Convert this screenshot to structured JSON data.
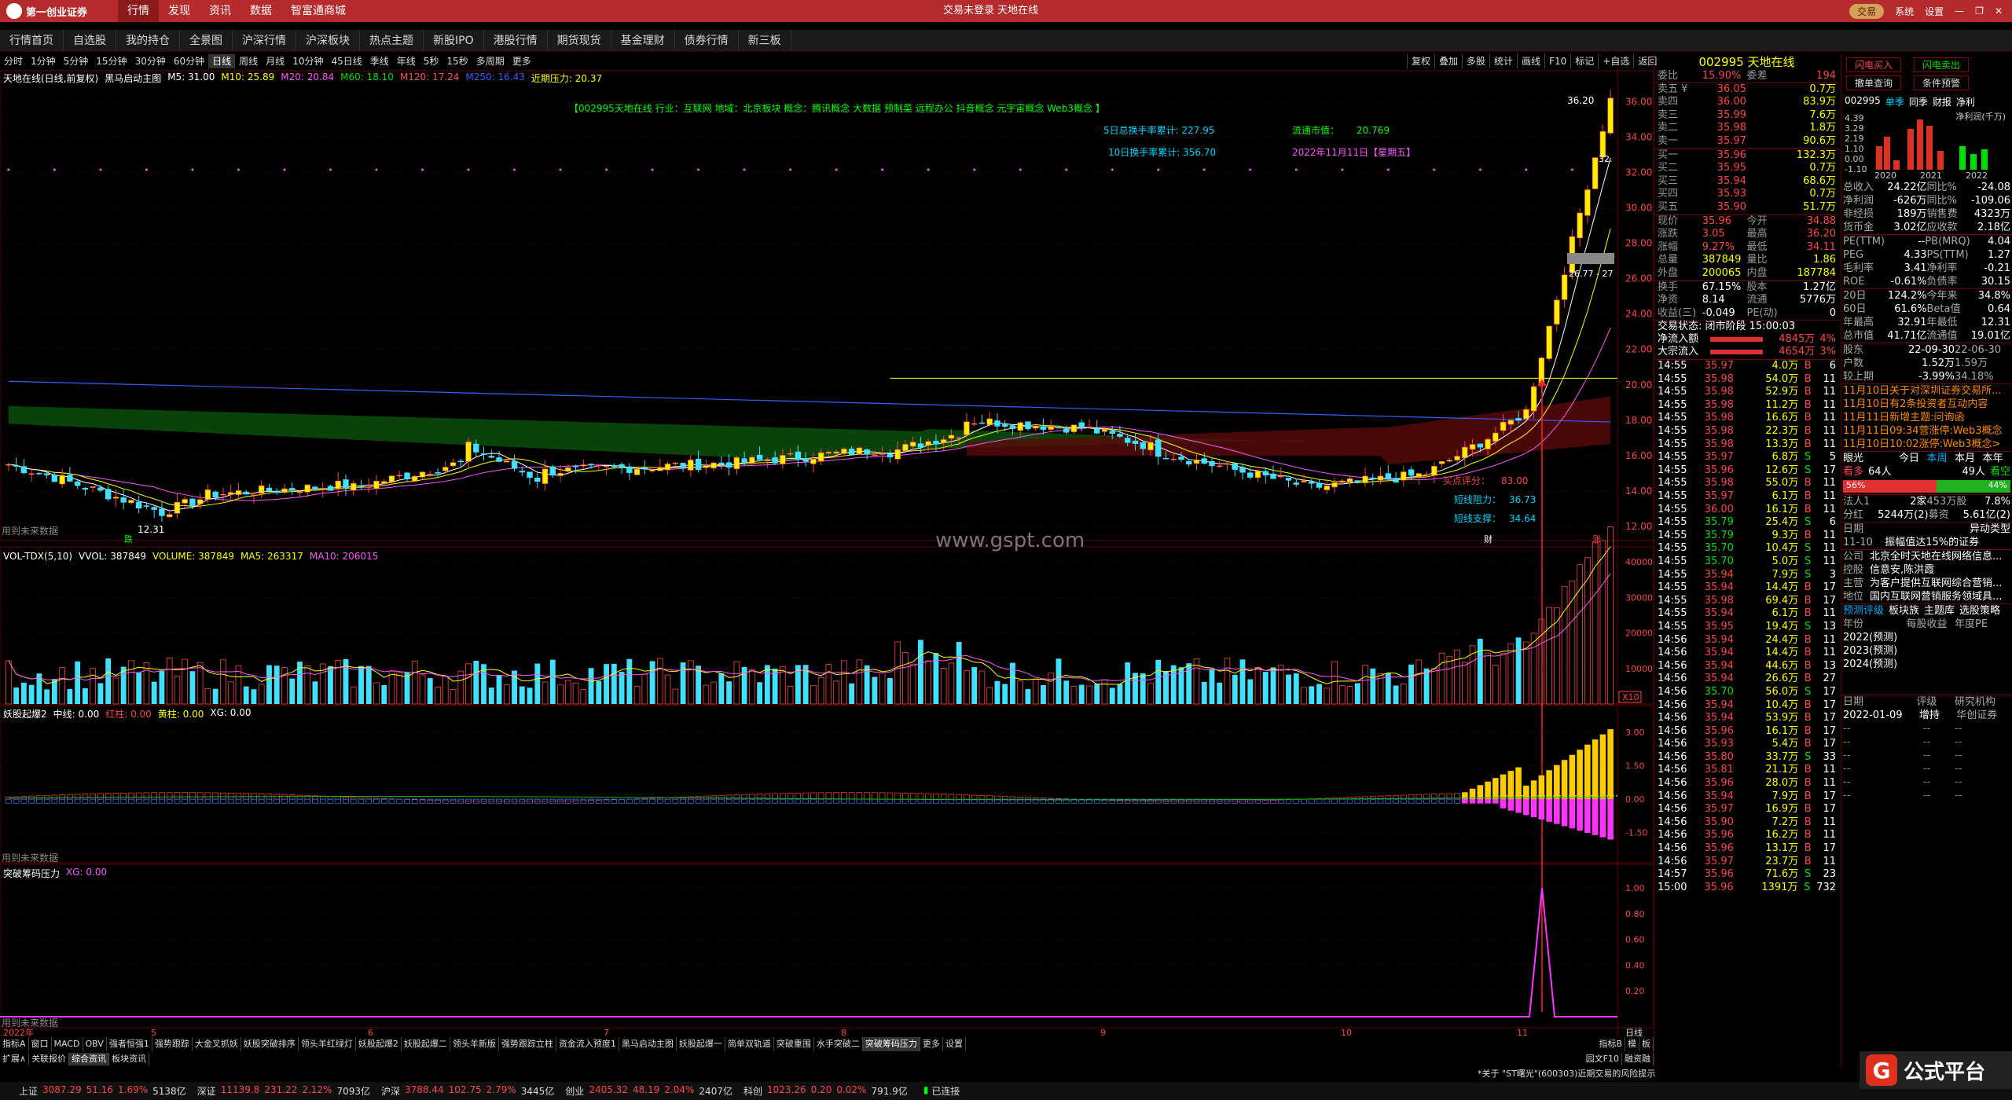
{
  "menubar": {
    "logo": "第一创业证券",
    "tabs": [
      "行情",
      "发现",
      "资讯",
      "数据",
      "智富通商城"
    ],
    "title": "交易未登录  天地在线",
    "trade": "交易",
    "system": "系统",
    "settings": "设置"
  },
  "subtabs": [
    "行情首页",
    "自选股",
    "我的持仓",
    "全景图",
    "沪深行情",
    "沪深板块",
    "热点主题",
    "新股IPO",
    "港股行情",
    "期货现货",
    "基金理财",
    "债券行情",
    "新三板"
  ],
  "periods": [
    "分时",
    "1分钟",
    "5分钟",
    "15分钟",
    "30分钟",
    "60分钟",
    "日线",
    "周线",
    "月线",
    "10分钟",
    "45日线",
    "季线",
    "年线",
    "5秒",
    "15秒",
    "多周期",
    "更多"
  ],
  "active_period": "日线",
  "chart_tools": [
    "复权",
    "叠加",
    "多股",
    "统计",
    "画线",
    "F10",
    "标记",
    "+自选",
    "返回"
  ],
  "main": {
    "stock": "天地在线(日线,前复权)",
    "indicator": "黑马启动主图",
    "ma": [
      {
        "label": "M5: 31.00",
        "color": "#ffffff"
      },
      {
        "label": "M10: 25.89",
        "color": "#ffff00"
      },
      {
        "label": "M20: 20.84",
        "color": "#ff55ff"
      },
      {
        "label": "M60: 18.10",
        "color": "#00e000"
      },
      {
        "label": "M120: 17.24",
        "color": "#ff5555"
      },
      {
        "label": "M250: 16.43",
        "color": "#3060ff"
      },
      {
        "label": "近期压力: 20.37",
        "color": "#ffff00"
      }
    ],
    "info": "【002995天地在线  行业：互联网  地域：北京板块  概念：腾讯概念 大数据 预制菜 远程办公 抖音概念 元宇宙概念 Web3概念 】",
    "turn5": "5日总换手率累计: 227.95",
    "turn10": "10日换手率累计: 356.70",
    "float": "流通市值：",
    "floatval": "20.769",
    "date": "2022年11月11日【星期五】",
    "hi": "36.20",
    "lo": "12.31",
    "box": "26.77 - 27",
    "pt32": "32.",
    "future": "用到未来数据",
    "buy_score": "买点评分：",
    "buy_val": "83.00",
    "short_res": "短线阻力：",
    "short_res_v": "36.73",
    "short_sup": "短线支撑：",
    "short_sup_v": "34.64",
    "zhang": "涨",
    "cai": "财",
    "die": "跌",
    "yaxis": [
      "36.00",
      "34.00",
      "32.00",
      "30.00",
      "28.00",
      "26.00",
      "24.00",
      "22.00",
      "20.00",
      "18.00",
      "16.00",
      "14.00",
      "12.00"
    ]
  },
  "vol": {
    "title": "VOL-TDX(5,10)",
    "items": [
      {
        "label": "VVOL: 387849",
        "color": "#ffffff"
      },
      {
        "label": "VOLUME: 387849",
        "color": "#ffff00"
      },
      {
        "label": "MA5: 263317",
        "color": "#ffff00"
      },
      {
        "label": "MA10: 206015",
        "color": "#ff55ff"
      }
    ],
    "yaxis": [
      "40000",
      "30000",
      "20000",
      "10000"
    ],
    "unit": "X10"
  },
  "ind2": {
    "title": "妖股起爆2",
    "items": [
      {
        "label": "中线: 0.00",
        "color": "#ffffff"
      },
      {
        "label": "红柱: 0.00",
        "color": "#ff4444"
      },
      {
        "label": "黄柱: 0.00",
        "color": "#ffff00"
      },
      {
        "label": "XG: 0.00",
        "color": "#ffffff"
      }
    ],
    "yaxis": [
      "3.00",
      "1.50",
      "0.00",
      "-1.50"
    ],
    "future": "用到未来数据"
  },
  "ind3": {
    "title": "突破筹码压力",
    "items": [
      {
        "label": "XG: 0.00",
        "color": "#ff55ff"
      }
    ],
    "yaxis": [
      "1.00",
      "0.80",
      "0.60",
      "0.40",
      "0.20"
    ],
    "future": "用到未来数据"
  },
  "xaxis": [
    "2022年",
    "5",
    "6",
    "7",
    "8",
    "9",
    "10",
    "11"
  ],
  "xaxis_right": "日线",
  "watermark": "www.gspt.com",
  "bottom_tabs": [
    "指标A",
    "窗口",
    "MACD",
    "OBV",
    "强者恒强1",
    "强势跟踪",
    "大金叉抓妖",
    "妖股突破排序",
    "领头羊红绿灯",
    "妖股起爆2",
    "妖股起爆二",
    "领头羊新版",
    "强势跟踪立柱",
    "资金流入预度1",
    "黑马启动主图",
    "妖股起爆一",
    "简单双轨道",
    "突破重围",
    "水手突破二",
    "突破筹码压力",
    "更多",
    "设置"
  ],
  "bottom_tabs_right": [
    "指标B",
    "模",
    "板"
  ],
  "bottom_tabs2": [
    "扩展∧",
    "关联报价",
    "综合资讯",
    "板块资讯"
  ],
  "bottom_tabs2_right": "园文F10",
  "bottom_tabs2_r2": "融资融",
  "quote": {
    "code": "002995",
    "name": "天地在线",
    "weibi": "委比",
    "weibi_v": "15.90%",
    "weicha": "委差",
    "weicha_v": "194",
    "sells": [
      {
        "l": "卖五 ¥",
        "p": "36.05",
        "v": "0.7万"
      },
      {
        "l": "卖四",
        "p": "36.00",
        "v": "83.9万"
      },
      {
        "l": "卖三",
        "p": "35.99",
        "v": "7.6万"
      },
      {
        "l": "卖二",
        "p": "35.98",
        "v": "1.8万"
      },
      {
        "l": "卖一",
        "p": "35.97",
        "v": "90.6万"
      }
    ],
    "buys": [
      {
        "l": "买一",
        "p": "35.96",
        "v": "132.3万"
      },
      {
        "l": "买二",
        "p": "35.95",
        "v": "0.7万"
      },
      {
        "l": "买三",
        "p": "35.94",
        "v": "68.6万"
      },
      {
        "l": "买四",
        "p": "35.93",
        "v": "0.7万"
      },
      {
        "l": "买五",
        "p": "35.90",
        "v": "51.7万"
      }
    ],
    "stats": [
      [
        "现价",
        "35.96",
        "今开",
        "34.88"
      ],
      [
        "涨跌",
        "3.05",
        "最高",
        "36.20"
      ],
      [
        "涨幅",
        "9.27%",
        "最低",
        "34.11"
      ],
      [
        "总量",
        "387849",
        "量比",
        "1.86"
      ],
      [
        "外盘",
        "200065",
        "内盘",
        "187784"
      ]
    ],
    "stats2": [
      [
        "换手",
        "67.15%",
        "股本",
        "1.27亿"
      ],
      [
        "净资",
        "8.14",
        "流通",
        "5776万"
      ],
      [
        "收益(三)",
        "-0.049",
        "PE(动)",
        "0"
      ]
    ],
    "status": "交易状态: 闭市阶段 15:00:03",
    "flow": [
      {
        "l": "净流入额",
        "v": "4845万",
        "p": "4%"
      },
      {
        "l": "大宗流入",
        "v": "4654万",
        "p": "3%"
      }
    ],
    "ticks": [
      [
        "14:55",
        "35.97",
        "4.0万",
        "B",
        "6"
      ],
      [
        "14:55",
        "35.98",
        "54.0万",
        "B",
        "11"
      ],
      [
        "14:55",
        "35.98",
        "52.9万",
        "B",
        "11"
      ],
      [
        "14:55",
        "35.98",
        "11.2万",
        "B",
        "11"
      ],
      [
        "14:55",
        "35.98",
        "16.6万",
        "B",
        "11"
      ],
      [
        "14:55",
        "35.98",
        "22.3万",
        "B",
        "11"
      ],
      [
        "14:55",
        "35.98",
        "13.3万",
        "B",
        "11"
      ],
      [
        "14:55",
        "35.97",
        "6.8万",
        "S",
        "5"
      ],
      [
        "14:55",
        "35.96",
        "12.6万",
        "S",
        "17"
      ],
      [
        "14:55",
        "35.98",
        "55.0万",
        "B",
        "11"
      ],
      [
        "14:55",
        "35.97",
        "6.1万",
        "B",
        "11"
      ],
      [
        "14:55",
        "36.00",
        "16.1万",
        "B",
        "11"
      ],
      [
        "14:55",
        "35.79",
        "25.4万",
        "S",
        "6"
      ],
      [
        "14:55",
        "35.79",
        "9.3万",
        "B",
        "11"
      ],
      [
        "14:55",
        "35.70",
        "10.4万",
        "S",
        "11"
      ],
      [
        "14:55",
        "35.70",
        "5.0万",
        "S",
        "11"
      ],
      [
        "14:55",
        "35.94",
        "7.9万",
        "S",
        "3"
      ],
      [
        "14:55",
        "35.94",
        "14.4万",
        "B",
        "17"
      ],
      [
        "14:55",
        "35.98",
        "69.4万",
        "B",
        "17"
      ],
      [
        "14:55",
        "35.94",
        "6.1万",
        "B",
        "11"
      ],
      [
        "14:55",
        "35.95",
        "19.4万",
        "S",
        "13"
      ],
      [
        "14:56",
        "35.94",
        "24.4万",
        "B",
        "11"
      ],
      [
        "14:56",
        "35.94",
        "14.4万",
        "B",
        "11"
      ],
      [
        "14:56",
        "35.94",
        "44.6万",
        "B",
        "13"
      ],
      [
        "14:56",
        "35.94",
        "26.6万",
        "B",
        "27"
      ],
      [
        "14:56",
        "35.70",
        "56.0万",
        "S",
        "17"
      ],
      [
        "14:56",
        "35.94",
        "10.4万",
        "B",
        "17"
      ],
      [
        "14:56",
        "35.94",
        "53.9万",
        "B",
        "17"
      ],
      [
        "14:56",
        "35.96",
        "16.1万",
        "B",
        "17"
      ],
      [
        "14:56",
        "35.93",
        "5.4万",
        "B",
        "17"
      ],
      [
        "14:56",
        "35.80",
        "33.7万",
        "S",
        "33"
      ],
      [
        "14:56",
        "35.81",
        "21.1万",
        "B",
        "11"
      ],
      [
        "14:56",
        "35.96",
        "28.0万",
        "B",
        "11"
      ],
      [
        "14:56",
        "35.94",
        "7.9万",
        "B",
        "17"
      ],
      [
        "14:56",
        "35.97",
        "16.9万",
        "B",
        "17"
      ],
      [
        "14:56",
        "35.90",
        "7.2万",
        "B",
        "11"
      ],
      [
        "14:56",
        "35.96",
        "16.2万",
        "B",
        "11"
      ],
      [
        "14:56",
        "35.96",
        "13.1万",
        "B",
        "17"
      ],
      [
        "14:56",
        "35.97",
        "23.7万",
        "B",
        "11"
      ],
      [
        "14:57",
        "35.96",
        "71.6万",
        "S",
        "23"
      ],
      [
        "15:00",
        "35.96",
        "1391万",
        "S",
        "732"
      ]
    ]
  },
  "f10": {
    "btn1": "闪电买入",
    "btn2": "闪电卖出",
    "btn3": "撤单查询",
    "btn4": "条件预警",
    "code": "002995",
    "tabs": [
      "单季",
      "同季",
      "财报",
      "净利"
    ],
    "unit": "净利润(千万)",
    "chart_y": [
      "4.39",
      "3.29",
      "2.19",
      "1.10",
      "0.00",
      "-1.10"
    ],
    "years": [
      "2020",
      "2021",
      "2022"
    ],
    "rows": [
      [
        "总收入",
        "24.22亿",
        "同比%",
        "-24.08"
      ],
      [
        "净利润",
        "-626万",
        "同比%",
        "-109.06"
      ],
      [
        "非经损",
        "189万",
        "销售费",
        "4323万"
      ],
      [
        "货币金",
        "3.02亿",
        "应收款",
        "2.18亿"
      ]
    ],
    "rows2": [
      [
        "PE(TTM)",
        "--",
        "PB(MRQ)",
        "4.04"
      ],
      [
        "PEG",
        "4.33",
        "PS(TTM)",
        "1.27"
      ],
      [
        "毛利率",
        "3.41",
        "净利率",
        "-0.21"
      ],
      [
        "ROE",
        "-0.61%",
        "负债率",
        "30.15"
      ]
    ],
    "rows3": [
      [
        "20日",
        "124.2%",
        "今年来",
        "34.8%"
      ],
      [
        "60日",
        "61.6%",
        "Beta值",
        "0.64"
      ],
      [
        "年最高",
        "32.91",
        "年最低",
        "12.31"
      ],
      [
        "总市值",
        "41.71亿",
        "流通值",
        "19.01亿"
      ]
    ],
    "rows4": [
      [
        "股东",
        "22-09-30",
        "",
        "22-06-30"
      ],
      [
        "户数",
        "1.52万",
        "",
        "1.59万"
      ],
      [
        "较上期",
        "-3.99%",
        "",
        "34.18%"
      ]
    ],
    "news": [
      "11月10日关于对深圳证券交易所...",
      "11月10日有2条投资者互动内容",
      "11月11日新增主题:问询函",
      "11月11日09:34营涨停:Web3概念",
      "11月10日10:02涨停:Web3概念>"
    ],
    "sentiment": {
      "title": "眼光",
      "tabs": [
        "今日",
        "本周",
        "本月",
        "本年"
      ],
      "bull": "看多",
      "bull_n": "64人",
      "bear_n": "49人",
      "bear": "看空",
      "bull_p": "56%",
      "bear_p": "44%"
    },
    "hold": [
      [
        "法人1",
        "2家",
        "453万股",
        "7.8%"
      ],
      [
        "分红",
        "5244万(2)",
        "募资",
        "5.61亿(2)"
      ]
    ],
    "anom_title": [
      "日期",
      "异动类型"
    ],
    "anom": [
      "11-10",
      "振幅值达15%的证券"
    ],
    "company": [
      [
        "公司",
        "北京全时天地在线网络信息..."
      ],
      [
        "控股",
        "信意安,陈洪霞"
      ],
      [
        "主营",
        "为客户提供互联网综合营销..."
      ],
      [
        "地位",
        "国内互联网营销服务领域具..."
      ]
    ],
    "predict_tabs": [
      "预测评级",
      "板块族",
      "主题库",
      "选股策略"
    ],
    "predict_hdr": [
      "年份",
      "每股收益",
      "年度PE"
    ],
    "predict": [
      "2022(预测)",
      "2023(预测)",
      "2024(预测)"
    ],
    "rating_hdr": [
      "日期",
      "评级",
      "研究机构"
    ],
    "rating": [
      "2022-01-09",
      "增持",
      "华创证券"
    ]
  },
  "statusbar": [
    {
      "n": "上证",
      "v": "3087.29",
      "c": "51.16",
      "p": "1.69%",
      "a": "5138亿"
    },
    {
      "n": "深证",
      "v": "11139.8",
      "c": "231.22",
      "p": "2.12%",
      "a": "7093亿"
    },
    {
      "n": "沪深",
      "v": "3788.44",
      "c": "102.75",
      "p": "2.79%",
      "a": "3445亿"
    },
    {
      "n": "创业",
      "v": "2405.32",
      "c": "48.19",
      "p": "2.04%",
      "a": "2407亿"
    },
    {
      "n": "科创",
      "v": "1023.26",
      "c": "0.20",
      "p": "0.02%",
      "a": "791.9亿"
    }
  ],
  "conn": "已连接",
  "notice": "*关于  \"ST曙光\"(600303)近期交易的风险提示",
  "brand": "公式平台"
}
